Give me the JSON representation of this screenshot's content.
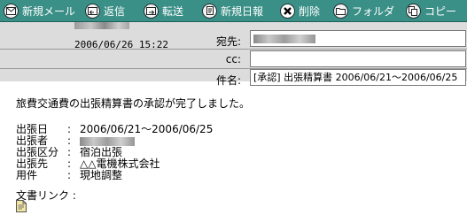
{
  "toolbar": {
    "new_mail": "新規メール",
    "reply": "返信",
    "forward": "転送",
    "new_daily_report": "新規日報",
    "delete": "削除",
    "folder": "フォルダ",
    "copy": "コピー",
    "icons": [
      "mail-icon",
      "reply-icon",
      "forward-icon",
      "report-icon",
      "delete-icon",
      "folder-icon",
      "copy-icon"
    ],
    "background": "#3a8f87"
  },
  "header": {
    "date": "2006/06/26 15:22",
    "to_label": "宛先:",
    "cc_label": "cc:",
    "subject_label": "件名:",
    "cc_value": "",
    "subject_value": "[承認] 出張精算書 2006/06/21～2006/06/25"
  },
  "body": {
    "message": "旅費交通費の出張精算書の承認が完了しました。",
    "rows": [
      {
        "label": "出張日",
        "sep": ":",
        "value": "2006/06/21～2006/06/25"
      },
      {
        "label": "出張者",
        "sep": ":",
        "value": ""
      },
      {
        "label": "出張区分",
        "sep": ":",
        "value": "宿泊出張"
      },
      {
        "label": "出張先",
        "sep": ":",
        "value": "△△電機株式会社"
      },
      {
        "label": "用件",
        "sep": ":",
        "value": "現地調整"
      }
    ],
    "doc_link_label": "文書リンク :"
  }
}
